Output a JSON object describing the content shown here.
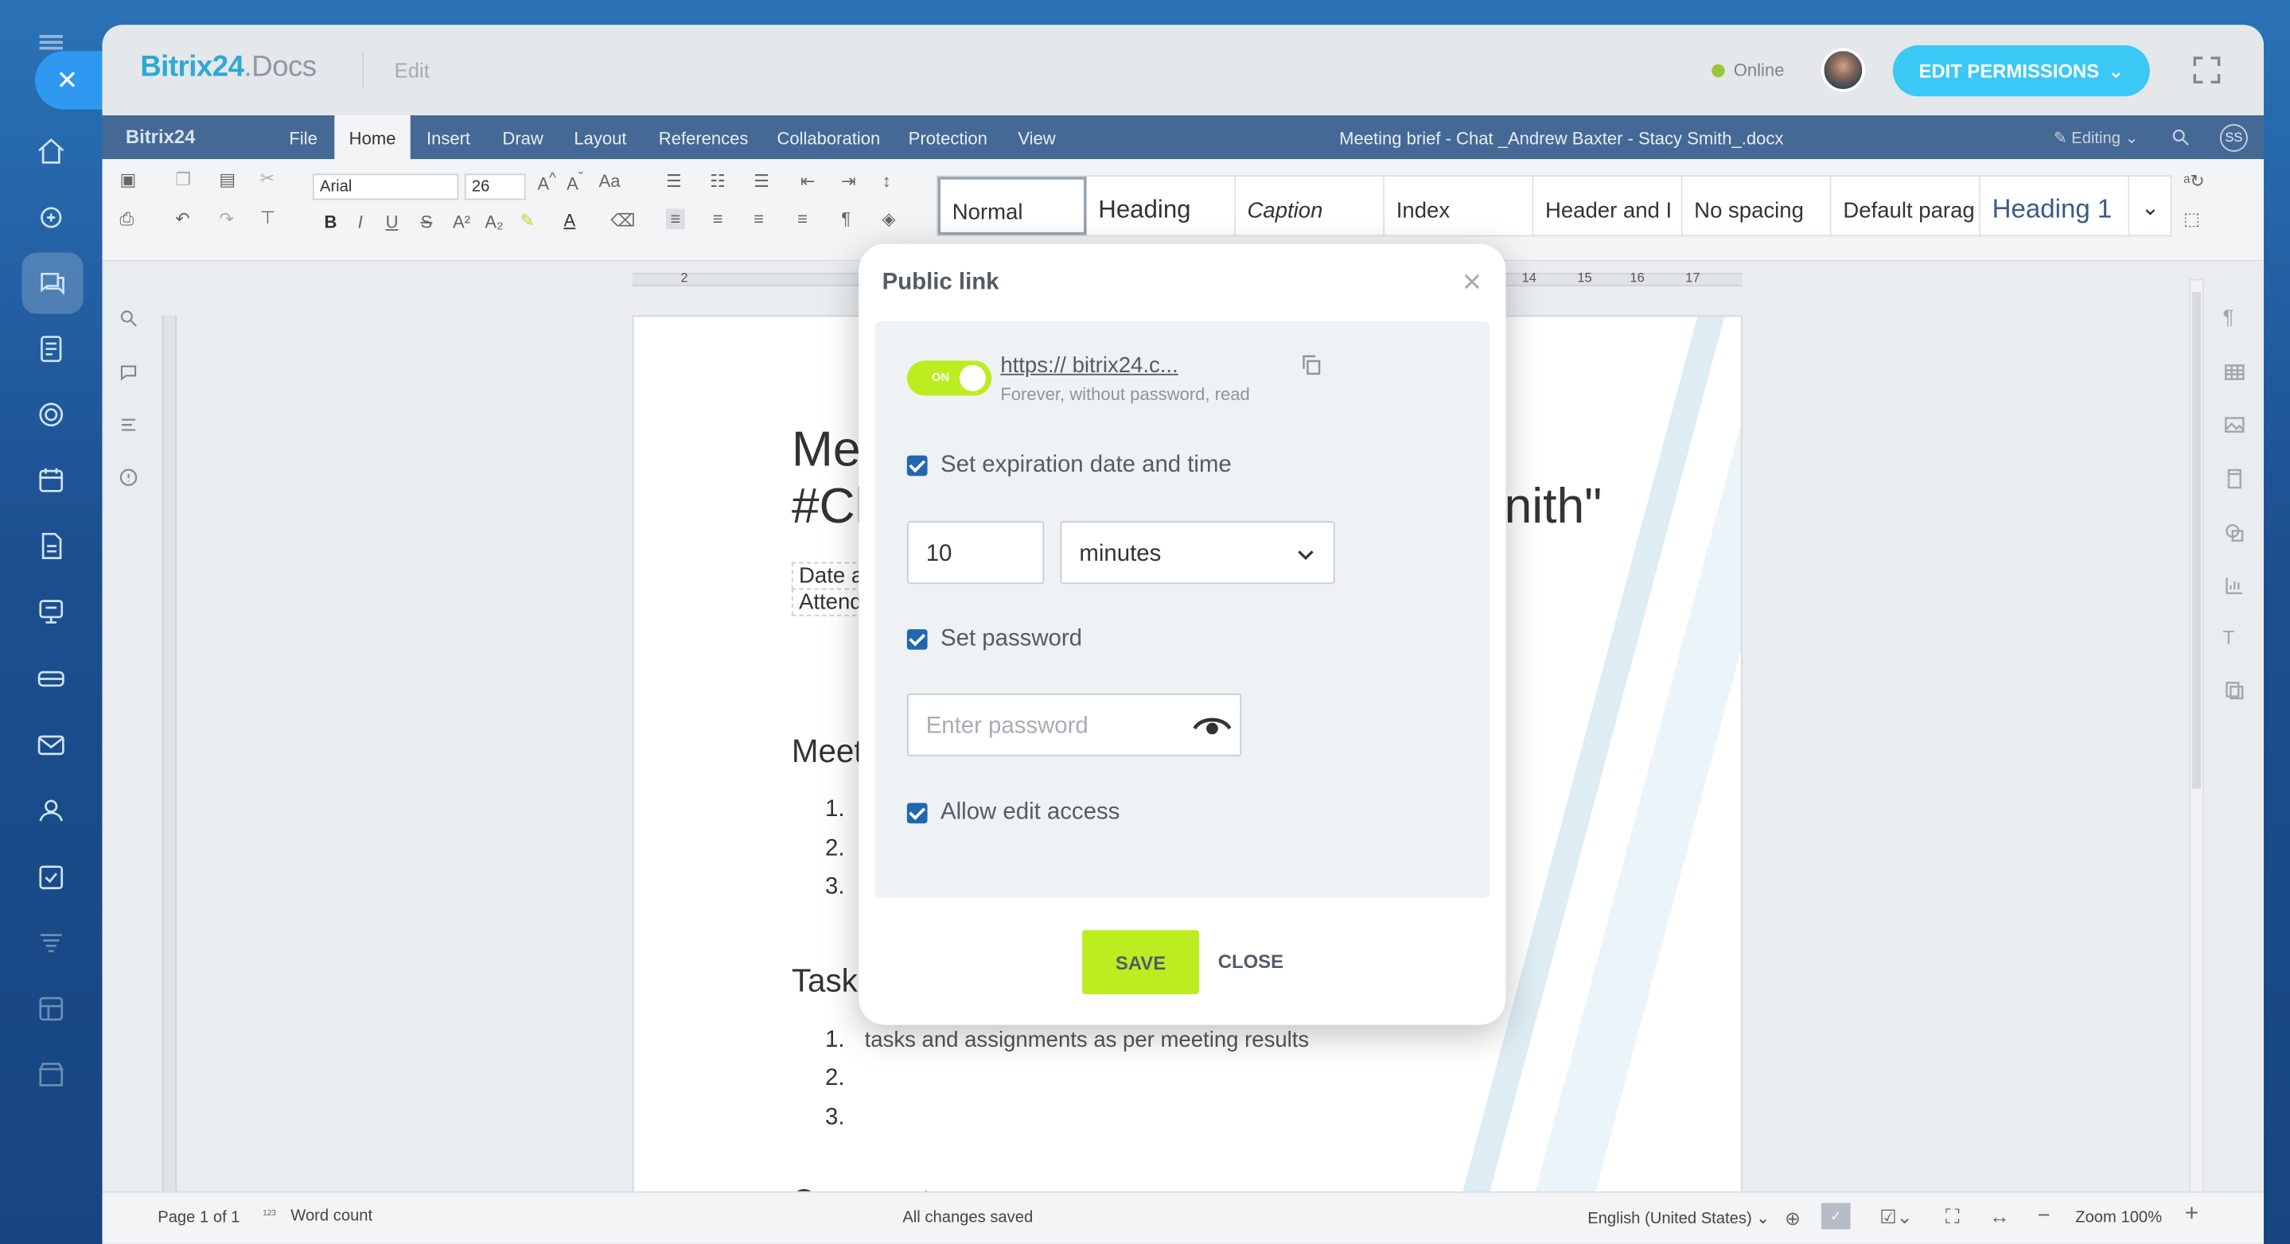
{
  "app": {
    "brand": "Bitrix24",
    "brand_suffix": ".Docs",
    "mode": "Edit",
    "status": "Online",
    "edit_permissions": "EDIT PERMISSIONS"
  },
  "editor": {
    "brand": "Bitrix24",
    "menus": [
      "File",
      "Home",
      "Insert",
      "Draw",
      "Layout",
      "References",
      "Collaboration",
      "Protection",
      "View"
    ],
    "active_menu": "Home",
    "doc_title": "Meeting brief - Chat _Andrew Baxter - Stacy Smith_.docx",
    "editing_mode": "Editing",
    "user_initials": "SS",
    "font_name": "Arial",
    "font_size": "26",
    "styles": [
      "Normal",
      "Heading",
      "Caption",
      "Index",
      "Header and I",
      "No spacing",
      "Default parag",
      "Heading 1"
    ],
    "selected_style": "Normal"
  },
  "document": {
    "title_line1": "Me",
    "title_line2": "#Cl",
    "title_tail": "nith\"",
    "date_label": "Date a",
    "attendees_label": "Attende",
    "section1": "Meet",
    "section2": "Task",
    "task_item1": "tasks and assignments as per meeting results",
    "list_numbers": [
      "1.",
      "2.",
      "3."
    ],
    "next_section": "Comments"
  },
  "ruler_marks": [
    "2",
    "14",
    "15",
    "16",
    "17"
  ],
  "status": {
    "page": "Page 1 of 1",
    "word_count": "Word count",
    "saved": "All changes saved",
    "language": "English (United States)",
    "zoom": "Zoom 100%"
  },
  "modal": {
    "title": "Public link",
    "toggle_label": "ON",
    "link_text": "https://            bitrix24.c...",
    "link_description": "Forever, without password, read",
    "expiration_label": "Set expiration date and time",
    "expiration_value": "10",
    "expiration_unit": "minutes",
    "password_label": "Set password",
    "password_placeholder": "Enter password",
    "edit_access_label": "Allow edit access",
    "save": "SAVE",
    "close": "CLOSE"
  },
  "colors": {
    "accent_green": "#bbed21",
    "brand_blue": "#3bc8f5",
    "menubar": "#446995",
    "checkbox": "#2066b0"
  },
  "icons": [
    "close-icon",
    "menu-icon",
    "home-icon",
    "chat-icon",
    "tasks-icon",
    "calendar-icon",
    "eye-icon",
    "copy-icon",
    "fullscreen-icon",
    "search-icon"
  ]
}
